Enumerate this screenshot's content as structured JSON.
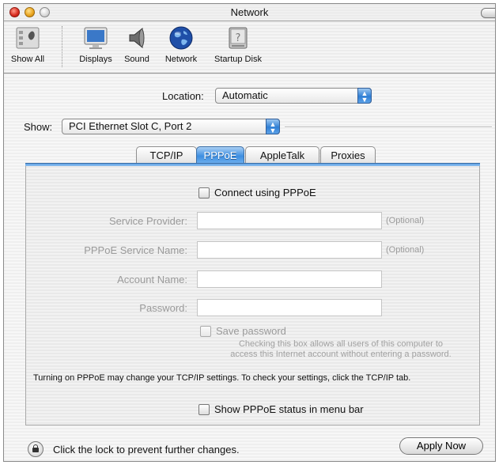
{
  "window": {
    "title": "Network"
  },
  "toolbar": {
    "items": [
      {
        "label": "Show All",
        "icon": "show-all-icon"
      },
      {
        "label": "Displays",
        "icon": "displays-icon"
      },
      {
        "label": "Sound",
        "icon": "sound-icon"
      },
      {
        "label": "Network",
        "icon": "network-globe-icon"
      },
      {
        "label": "Startup Disk",
        "icon": "startup-disk-icon"
      }
    ]
  },
  "location": {
    "label": "Location:",
    "value": "Automatic"
  },
  "show": {
    "label": "Show:",
    "value": "PCI Ethernet Slot C, Port 2"
  },
  "tabs": [
    {
      "label": "TCP/IP",
      "active": false
    },
    {
      "label": "PPPoE",
      "active": true
    },
    {
      "label": "AppleTalk",
      "active": false
    },
    {
      "label": "Proxies",
      "active": false
    }
  ],
  "pppoe": {
    "connect_label": "Connect using PPPoE",
    "fields": [
      {
        "label": "Service Provider:",
        "value": "",
        "optional": "(Optional)"
      },
      {
        "label": "PPPoE Service Name:",
        "value": "",
        "optional": "(Optional)"
      },
      {
        "label": "Account Name:",
        "value": ""
      },
      {
        "label": "Password:",
        "value": ""
      }
    ],
    "save_password_label": "Save password",
    "save_password_help_1": "Checking this box allows all users of this computer to",
    "save_password_help_2": "access this Internet account without entering a password.",
    "note": "Turning on PPPoE may change your TCP/IP settings. To check your settings, click the TCP/IP tab.",
    "status_label": "Show PPPoE status in menu bar"
  },
  "footer": {
    "lock_text": "Click the lock to prevent further changes.",
    "apply_label": "Apply Now"
  },
  "colors": {
    "accent": "#3d8ee0",
    "disabled_text": "#9a9a9a"
  }
}
